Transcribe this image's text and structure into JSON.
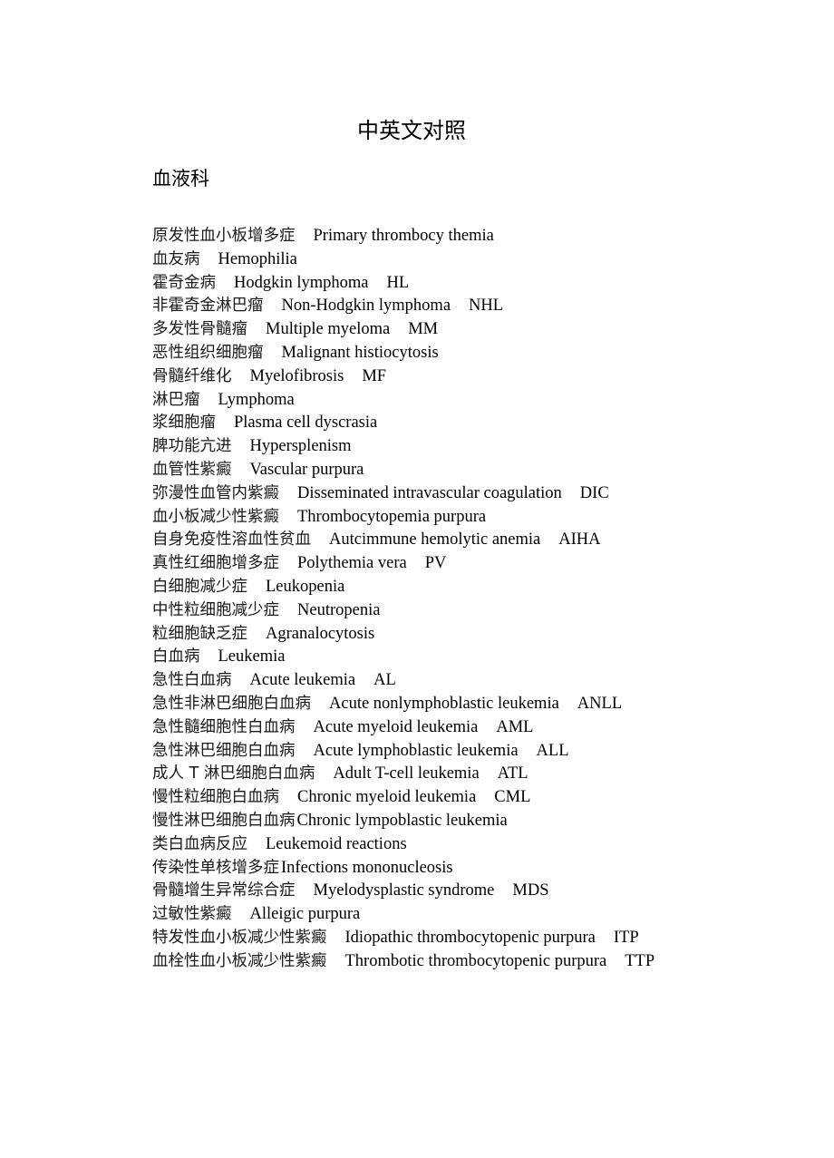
{
  "document": {
    "title": "中英文对照",
    "section": "血液科",
    "entries": [
      {
        "zh": "原发性血小板增多症",
        "en": "Primary thrombocy themia",
        "abbr": ""
      },
      {
        "zh": "血友病",
        "en": "Hemophilia",
        "abbr": ""
      },
      {
        "zh": "霍奇金病",
        "en": "Hodgkin lymphoma",
        "abbr": "HL"
      },
      {
        "zh": "非霍奇金淋巴瘤",
        "en": "Non-Hodgkin lymphoma",
        "abbr": "NHL"
      },
      {
        "zh": "多发性骨髓瘤",
        "en": "Multiple myeloma",
        "abbr": "MM"
      },
      {
        "zh": "恶性组织细胞瘤",
        "en": "Malignant histiocytosis",
        "abbr": ""
      },
      {
        "zh": "骨髓纤维化",
        "en": "Myelofibrosis",
        "abbr": "MF"
      },
      {
        "zh": "淋巴瘤",
        "en": "Lymphoma",
        "abbr": ""
      },
      {
        "zh": "浆细胞瘤",
        "en": "Plasma cell dyscrasia",
        "abbr": ""
      },
      {
        "zh": "脾功能亢进",
        "en": "Hypersplenism",
        "abbr": ""
      },
      {
        "zh": "血管性紫癜",
        "en": "Vascular purpura",
        "abbr": ""
      },
      {
        "zh": "弥漫性血管内紫癜",
        "en": "Disseminated intravascular coagulation",
        "abbr": "DIC"
      },
      {
        "zh": "血小板减少性紫癜",
        "en": "Thrombocytopemia purpura",
        "abbr": ""
      },
      {
        "zh": "自身免疫性溶血性贫血",
        "en": "Autcimmune hemolytic anemia",
        "abbr": "AIHA"
      },
      {
        "zh": "真性红细胞增多症",
        "en": "Polythemia vera",
        "abbr": "PV"
      },
      {
        "zh": "白细胞减少症",
        "en": "Leukopenia",
        "abbr": ""
      },
      {
        "zh": "中性粒细胞减少症",
        "en": "Neutropenia",
        "abbr": ""
      },
      {
        "zh": "粒细胞缺乏症",
        "en": "Agranalocytosis",
        "abbr": ""
      },
      {
        "zh": "白血病",
        "en": "Leukemia",
        "abbr": ""
      },
      {
        "zh": "急性白血病",
        "en": "Acute leukemia",
        "abbr": "AL"
      },
      {
        "zh": "急性非淋巴细胞白血病",
        "en": "Acute nonlymphoblastic leukemia",
        "abbr": "ANLL"
      },
      {
        "zh": "急性髓细胞性白血病",
        "en": "Acute myeloid leukemia",
        "abbr": "AML"
      },
      {
        "zh": "急性淋巴细胞白血病",
        "en": "Acute lymphoblastic leukemia",
        "abbr": "ALL"
      },
      {
        "zh": "成人 T 淋巴细胞白血病",
        "en": "Adult T-cell leukemia",
        "abbr": "ATL"
      },
      {
        "zh": "慢性粒细胞白血病",
        "en": "Chronic myeloid leukemia",
        "abbr": "CML"
      },
      {
        "zh": "慢性淋巴细胞白血病",
        "en": "Chronic lympoblastic leukemia",
        "abbr": "",
        "narrow": true
      },
      {
        "zh": "类白血病反应",
        "en": "Leukemoid reactions",
        "abbr": ""
      },
      {
        "zh": "传染性单核增多症",
        "en": "Infections mononucleosis",
        "abbr": "",
        "narrow": true
      },
      {
        "zh": "骨髓增生异常综合症",
        "en": "Myelodysplastic syndrome",
        "abbr": "MDS"
      },
      {
        "zh": "过敏性紫癜",
        "en": "Alleigic purpura",
        "abbr": ""
      },
      {
        "zh": "特发性血小板减少性紫癜",
        "en": "Idiopathic thrombocytopenic purpura",
        "abbr": "ITP"
      },
      {
        "zh": "血栓性血小板减少性紫癜",
        "en": "Thrombotic thrombocytopenic purpura",
        "abbr": "TTP"
      }
    ]
  }
}
